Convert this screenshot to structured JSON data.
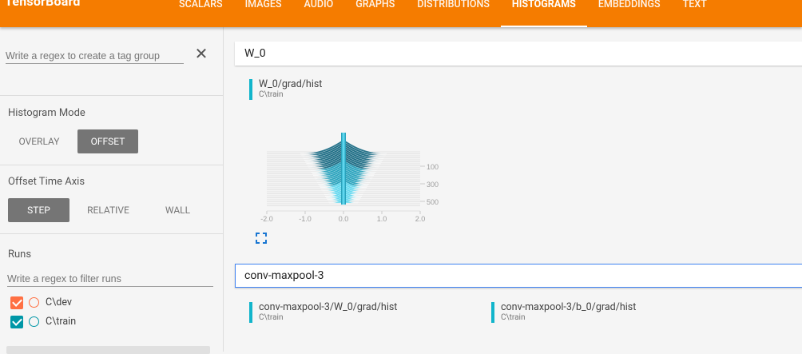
{
  "brand": "TensorBoard",
  "tabs": [
    {
      "label": "SCALARS"
    },
    {
      "label": "IMAGES"
    },
    {
      "label": "AUDIO"
    },
    {
      "label": "GRAPHS"
    },
    {
      "label": "DISTRIBUTIONS"
    },
    {
      "label": "HISTOGRAMS",
      "active": true
    },
    {
      "label": "EMBEDDINGS"
    },
    {
      "label": "TEXT"
    }
  ],
  "sidebar": {
    "tag_regex_placeholder": "Write a regex to create a tag group",
    "histogram_mode": {
      "title": "Histogram Mode",
      "options": [
        "OVERLAY",
        "OFFSET"
      ],
      "selected": "OFFSET"
    },
    "offset_time_axis": {
      "title": "Offset Time Axis",
      "options": [
        "STEP",
        "RELATIVE",
        "WALL"
      ],
      "selected": "STEP"
    },
    "runs": {
      "title": "Runs",
      "filter_placeholder": "Write a regex to filter runs",
      "items": [
        {
          "label": "C\\dev",
          "checked": true,
          "color": "#ff7043"
        },
        {
          "label": "C\\train",
          "checked": true,
          "color": "#0097a7"
        }
      ]
    }
  },
  "main": {
    "groups": [
      {
        "name": "W_0",
        "cards": [
          {
            "tag": "W_0/grad/hist",
            "run": "C\\train"
          }
        ]
      },
      {
        "name": "conv-maxpool-3",
        "cards": [
          {
            "tag": "conv-maxpool-3/W_0/grad/hist",
            "run": "C\\train"
          },
          {
            "tag": "conv-maxpool-3/b_0/grad/hist",
            "run": "C\\train"
          }
        ]
      }
    ]
  },
  "chart_data": {
    "type": "area",
    "mode": "offset",
    "x_ticks": [
      "-2.0",
      "-1.0",
      "0.0",
      "1.0",
      "2.0"
    ],
    "y_ticks": [
      "100",
      "300",
      "500"
    ],
    "colors": [
      "#1f6e86",
      "#2aa3bd",
      "#5fd7ee"
    ]
  }
}
